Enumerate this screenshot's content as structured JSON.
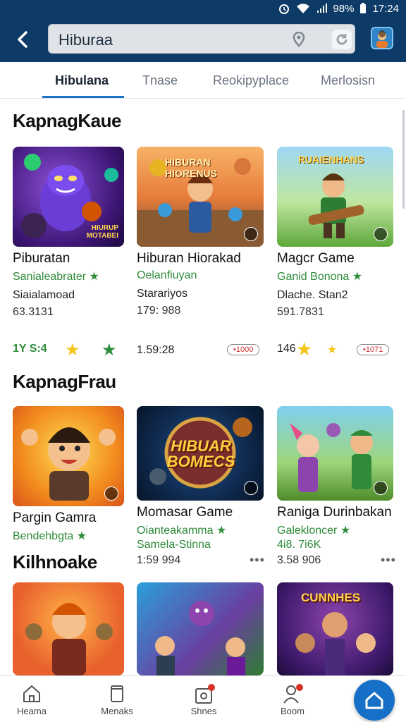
{
  "status_bar": {
    "battery": "98%",
    "time": "17:24"
  },
  "search": {
    "query": "Hiburaa"
  },
  "tabs": [
    {
      "label": "Hibulana"
    },
    {
      "label": "Tnase"
    },
    {
      "label": "Reokipyplace"
    },
    {
      "label": "Merlosisn"
    }
  ],
  "sections": [
    {
      "title": "KapnagKaue",
      "cards": [
        {
          "title": "Piburatan",
          "subtitle": "Sanialeabrater ★",
          "meta1": "Siaialamoad",
          "meta2": "63.3131",
          "thumb_text": "HIURUP MOTABEI"
        },
        {
          "title": "Hiburan Hiorakad",
          "subtitle": "Oelanfiuyan",
          "meta1": "Starariyos",
          "meta2": "179: 988",
          "thumb_text": "HIBURAN HIORENUS"
        },
        {
          "title": "Magcr Game",
          "subtitle": "Ganid Bonona ★",
          "meta1": "Dlache. Stan2",
          "meta2": "591.7831",
          "thumb_text": "RUAIENHANS"
        }
      ],
      "rating_row": {
        "left": "1Y S:4",
        "middle": "1.59:28",
        "middle_pill": "•1000",
        "right_value": "146",
        "right_pill": "•1071"
      }
    },
    {
      "title": "KapnagFrau",
      "cards": [
        {
          "title": "Pargin Gamra",
          "subtitle": "Bendehbgta ★",
          "meta1": "",
          "meta2": "",
          "thumb_text": ""
        },
        {
          "title": "Momasar Game",
          "subtitle": "Oianteakamma ★",
          "meta1": "Samela-Stinna",
          "meta2": "1:59 994",
          "thumb_text": "HIBUAR BOMECS"
        },
        {
          "title": "Raniga Durinbakan",
          "subtitle": "Galekloncer ★",
          "meta1": "4i8. 7i6K",
          "meta2": "3.58 906",
          "thumb_text": ""
        }
      ]
    },
    {
      "title": "Kilhnoake",
      "cards": [
        {
          "thumb_text": ""
        },
        {
          "thumb_text": ""
        },
        {
          "thumb_text": "CUNNHES"
        }
      ]
    }
  ],
  "bottom_nav": [
    {
      "label": "Heama"
    },
    {
      "label": "Menaks"
    },
    {
      "label": "Shnes"
    },
    {
      "label": "Boom"
    }
  ],
  "colors": {
    "header": "#0d3a66",
    "accent": "#1a73c8",
    "green": "#2e8b3a",
    "star": "#f5c518"
  }
}
